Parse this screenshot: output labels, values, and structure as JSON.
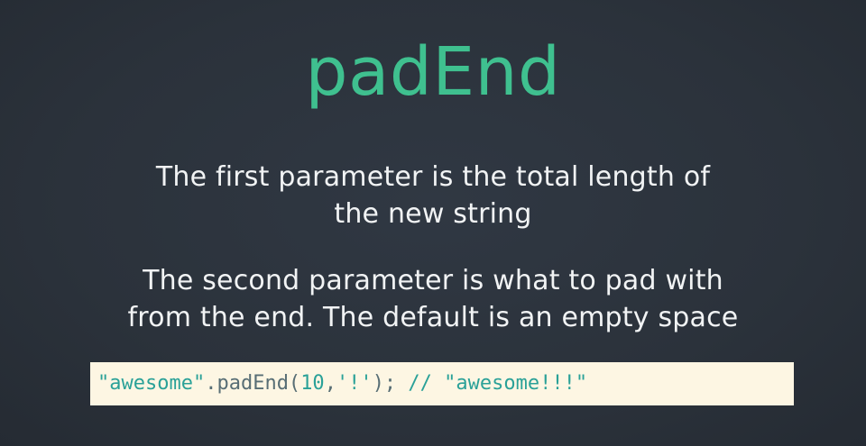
{
  "slide": {
    "title": "padEnd",
    "paragraph1": {
      "line1": "The first parameter is the total length of",
      "line2": "the new string"
    },
    "paragraph2": {
      "line1": "The second parameter is what to pad with",
      "line2": "from the end. The default is an empty space"
    },
    "code": {
      "tokens": {
        "string_literal": "\"awesome\"",
        "method_call": ".padEnd(",
        "length_arg": "10",
        "comma": ",",
        "pad_arg": "'!'",
        "close": ");",
        "comment": " // \"awesome!!!\""
      }
    }
  },
  "colors": {
    "background": "#2c333c",
    "title": "#3fc08f",
    "body_text": "#f1f3f4",
    "code_background": "#fdf6e3",
    "code_string": "#2aa198",
    "code_plain": "#586e75"
  }
}
